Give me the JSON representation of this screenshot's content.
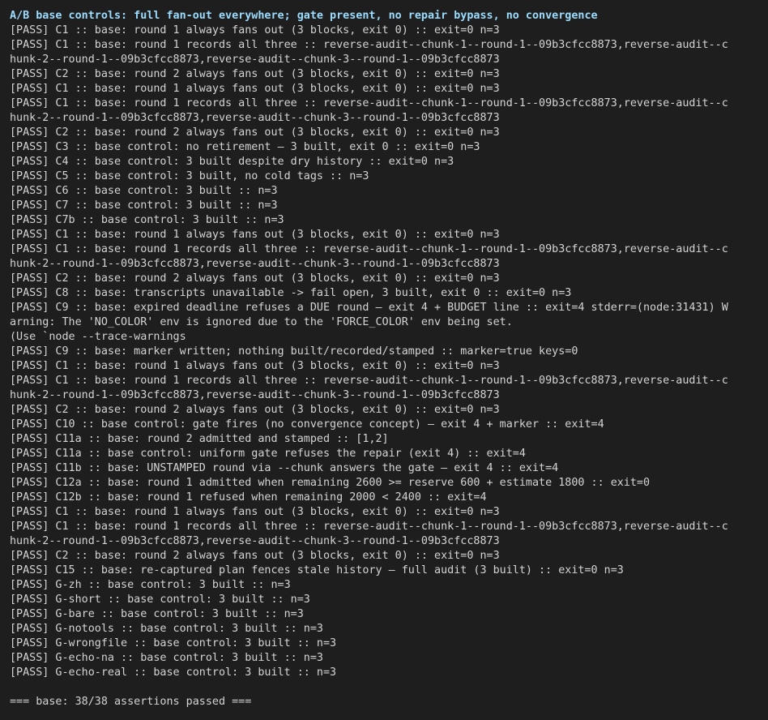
{
  "terminal": {
    "header": "A/B base controls: full fan-out everywhere; gate present, no repair bypass, no convergence",
    "lines": [
      "[PASS] C1 :: base: round 1 always fans out (3 blocks, exit 0) :: exit=0 n=3",
      "[PASS] C1 :: base: round 1 records all three :: reverse-audit--chunk-1--round-1--09b3cfcc8873,reverse-audit--c",
      "hunk-2--round-1--09b3cfcc8873,reverse-audit--chunk-3--round-1--09b3cfcc8873",
      "[PASS] C2 :: base: round 2 always fans out (3 blocks, exit 0) :: exit=0 n=3",
      "[PASS] C1 :: base: round 1 always fans out (3 blocks, exit 0) :: exit=0 n=3",
      "[PASS] C1 :: base: round 1 records all three :: reverse-audit--chunk-1--round-1--09b3cfcc8873,reverse-audit--c",
      "hunk-2--round-1--09b3cfcc8873,reverse-audit--chunk-3--round-1--09b3cfcc8873",
      "[PASS] C2 :: base: round 2 always fans out (3 blocks, exit 0) :: exit=0 n=3",
      "[PASS] C3 :: base control: no retirement — 3 built, exit 0 :: exit=0 n=3",
      "[PASS] C4 :: base control: 3 built despite dry history :: exit=0 n=3",
      "[PASS] C5 :: base control: 3 built, no cold tags :: n=3",
      "[PASS] C6 :: base control: 3 built :: n=3",
      "[PASS] C7 :: base control: 3 built :: n=3",
      "[PASS] C7b :: base control: 3 built :: n=3",
      "[PASS] C1 :: base: round 1 always fans out (3 blocks, exit 0) :: exit=0 n=3",
      "[PASS] C1 :: base: round 1 records all three :: reverse-audit--chunk-1--round-1--09b3cfcc8873,reverse-audit--c",
      "hunk-2--round-1--09b3cfcc8873,reverse-audit--chunk-3--round-1--09b3cfcc8873",
      "[PASS] C2 :: base: round 2 always fans out (3 blocks, exit 0) :: exit=0 n=3",
      "[PASS] C8 :: base: transcripts unavailable -> fail open, 3 built, exit 0 :: exit=0 n=3",
      "[PASS] C9 :: base: expired deadline refuses a DUE round — exit 4 + BUDGET line :: exit=4 stderr=(node:31431) W",
      "arning: The 'NO_COLOR' env is ignored due to the 'FORCE_COLOR' env being set.",
      "(Use `node --trace-warnings",
      "[PASS] C9 :: base: marker written; nothing built/recorded/stamped :: marker=true keys=0",
      "[PASS] C1 :: base: round 1 always fans out (3 blocks, exit 0) :: exit=0 n=3",
      "[PASS] C1 :: base: round 1 records all three :: reverse-audit--chunk-1--round-1--09b3cfcc8873,reverse-audit--c",
      "hunk-2--round-1--09b3cfcc8873,reverse-audit--chunk-3--round-1--09b3cfcc8873",
      "[PASS] C2 :: base: round 2 always fans out (3 blocks, exit 0) :: exit=0 n=3",
      "[PASS] C10 :: base control: gate fires (no convergence concept) — exit 4 + marker :: exit=4",
      "[PASS] C11a :: base: round 2 admitted and stamped :: [1,2]",
      "[PASS] C11a :: base control: uniform gate refuses the repair (exit 4) :: exit=4",
      "[PASS] C11b :: base: UNSTAMPED round via --chunk answers the gate — exit 4 :: exit=4",
      "[PASS] C12a :: base: round 1 admitted when remaining 2600 >= reserve 600 + estimate 1800 :: exit=0",
      "[PASS] C12b :: base: round 1 refused when remaining 2000 < 2400 :: exit=4",
      "[PASS] C1 :: base: round 1 always fans out (3 blocks, exit 0) :: exit=0 n=3",
      "[PASS] C1 :: base: round 1 records all three :: reverse-audit--chunk-1--round-1--09b3cfcc8873,reverse-audit--c",
      "hunk-2--round-1--09b3cfcc8873,reverse-audit--chunk-3--round-1--09b3cfcc8873",
      "[PASS] C2 :: base: round 2 always fans out (3 blocks, exit 0) :: exit=0 n=3",
      "[PASS] C15 :: base: re-captured plan fences stale history — full audit (3 built) :: exit=0 n=3",
      "[PASS] G-zh :: base control: 3 built :: n=3",
      "[PASS] G-short :: base control: 3 built :: n=3",
      "[PASS] G-bare :: base control: 3 built :: n=3",
      "[PASS] G-notools :: base control: 3 built :: n=3",
      "[PASS] G-wrongfile :: base control: 3 built :: n=3",
      "[PASS] G-echo-na :: base control: 3 built :: n=3",
      "[PASS] G-echo-real :: base control: 3 built :: n=3"
    ],
    "summary": "=== base: 38/38 assertions passed ===",
    "colors": {
      "background": "#1e1e1e",
      "text": "#d4d4d4",
      "header": "#9cdcfe"
    }
  }
}
